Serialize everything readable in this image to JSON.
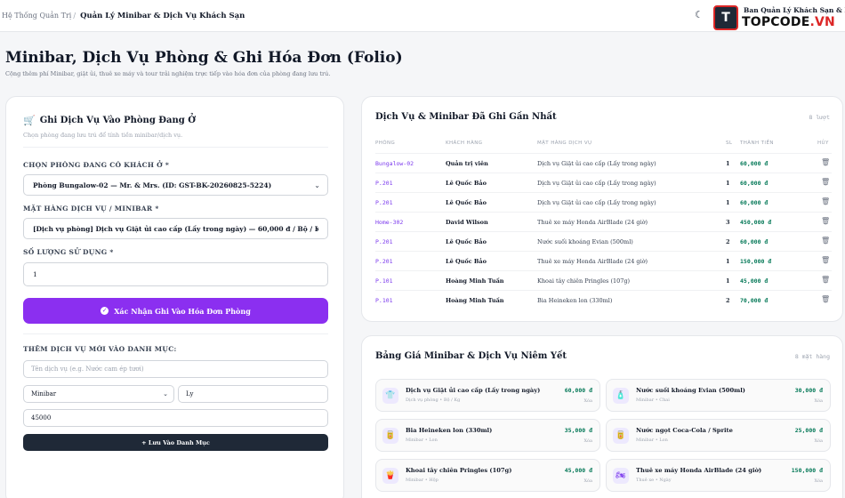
{
  "topbar": {
    "breadcrumb_root": "Hệ Thống Quản Trị",
    "breadcrumb_sep": "/",
    "breadcrumb_current": "Quản Lý Minibar & Dịch Vụ Khách Sạn",
    "theme_icon": "moon-icon",
    "admin_name": "Ban Quản Lý Khách Sạn & Homestay",
    "logo_badge": "T",
    "logo_text_a": "TOPCODE",
    "logo_text_b": ".VN"
  },
  "page": {
    "title": "Minibar, Dịch Vụ Phòng & Ghi Hóa Đơn (Folio)",
    "subtitle": "Cộng thêm phí Minibar, giặt ủi, thuê xe máy và tour trải nghiệm trực tiếp vào hóa đơn của phòng đang lưu trú."
  },
  "form": {
    "title": "Ghi Dịch Vụ Vào Phòng Đang Ở",
    "subtitle": "Chọn phòng đang lưu trú để tính tiền minibar/dịch vụ.",
    "room_label": "CHỌN PHÒNG ĐANG CÓ KHÁCH Ở *",
    "room_value": "Phòng Bungalow-02 — Mr. & Mrs. (ID: GST-BK-20260825-5224)",
    "item_label": "MẶT HÀNG DỊCH VỤ / MINIBAR *",
    "item_value": "[Dịch vụ phòng] Dịch vụ Giặt ủi cao cấp (Lấy trong ngày) — 60,000 đ / Bộ / Kg",
    "qty_label": "SỐ LƯỢNG SỬ DỤNG *",
    "qty_value": "1",
    "submit_label": "Xác Nhận Ghi Vào Hóa Đơn Phòng",
    "new_label": "THÊM DỊCH VỤ MỚI VÀO DANH MỤC:",
    "new_name_placeholder": "Tên dịch vụ (e.g. Nước cam ép tươi)",
    "new_category": "Minibar",
    "new_unit": "Ly",
    "new_price": "45000",
    "save_label": "+ Lưu Vào Danh Mục"
  },
  "log": {
    "title": "Dịch Vụ & Minibar Đã Ghi Gần Nhất",
    "count": "8 lượt",
    "columns": [
      "PHÒNG",
      "KHÁCH HÀNG",
      "MẶT HÀNG DỊCH VỤ",
      "SL",
      "THÀNH TIỀN",
      "HỦY"
    ],
    "rows": [
      {
        "room": "Bungalow-02",
        "guest": "Quản trị viên",
        "item": "Dịch vụ Giặt ủi cao cấp (Lấy trong ngày)",
        "qty": "1",
        "amount": "60,000 đ"
      },
      {
        "room": "P.201",
        "guest": "Lê Quốc Bảo",
        "item": "Dịch vụ Giặt ủi cao cấp (Lấy trong ngày)",
        "qty": "1",
        "amount": "60,000 đ"
      },
      {
        "room": "P.201",
        "guest": "Lê Quốc Bảo",
        "item": "Dịch vụ Giặt ủi cao cấp (Lấy trong ngày)",
        "qty": "1",
        "amount": "60,000 đ"
      },
      {
        "room": "Home-302",
        "guest": "David Wilson",
        "item": "Thuê xe máy Honda AirBlade (24 giờ)",
        "qty": "3",
        "amount": "450,000 đ"
      },
      {
        "room": "P.201",
        "guest": "Lê Quốc Bảo",
        "item": "Nước suối khoáng Evian (500ml)",
        "qty": "2",
        "amount": "60,000 đ"
      },
      {
        "room": "P.201",
        "guest": "Lê Quốc Bảo",
        "item": "Thuê xe máy Honda AirBlade (24 giờ)",
        "qty": "1",
        "amount": "150,000 đ"
      },
      {
        "room": "P.101",
        "guest": "Hoàng Minh Tuấn",
        "item": "Khoai tây chiên Pringles (107g)",
        "qty": "1",
        "amount": "45,000 đ"
      },
      {
        "room": "P.101",
        "guest": "Hoàng Minh Tuấn",
        "item": "Bia Heineken lon (330ml)",
        "qty": "2",
        "amount": "70,000 đ"
      }
    ]
  },
  "prices": {
    "title": "Bảng Giá Minibar & Dịch Vụ Niêm Yết",
    "count": "8 mặt hàng",
    "delete_label": "Xóa",
    "items": [
      {
        "name": "Dịch vụ Giặt ủi cao cấp (Lấy trong ngày)",
        "meta": "Dịch vụ phòng • Bộ / Kg",
        "price": "60,000 đ",
        "icon": "shirt-icon",
        "glyph": "👕"
      },
      {
        "name": "Nước suối khoáng Evian (500ml)",
        "meta": "Minibar • Chai",
        "price": "30,000 đ",
        "icon": "bottle-icon",
        "glyph": "🧴"
      },
      {
        "name": "Bia Heineken lon (330ml)",
        "meta": "Minibar • Lon",
        "price": "35,000 đ",
        "icon": "can-icon",
        "glyph": "🥫"
      },
      {
        "name": "Nước ngọt Coca-Cola / Sprite",
        "meta": "Minibar • Lon",
        "price": "25,000 đ",
        "icon": "can-icon",
        "glyph": "🥫"
      },
      {
        "name": "Khoai tây chiên Pringles (107g)",
        "meta": "Minibar • Hộp",
        "price": "45,000 đ",
        "icon": "snack-icon",
        "glyph": "🍟"
      },
      {
        "name": "Thuê xe máy Honda AirBlade (24 giờ)",
        "meta": "Thuê xe • Ngày",
        "price": "150,000 đ",
        "icon": "motorbike-icon",
        "glyph": "🏍"
      }
    ]
  }
}
